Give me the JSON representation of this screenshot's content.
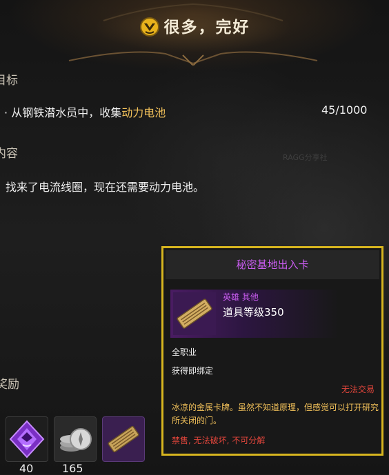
{
  "header": {
    "title": "很多，完好",
    "badge_icon": "gold-emblem-icon"
  },
  "objective": {
    "heading": "目标",
    "bullet": "·",
    "text_prefix": "从钢铁潜水员中，收集",
    "text_highlight": "动力电池",
    "progress": "45/1000"
  },
  "content": {
    "heading": "内容",
    "text": "找来了电流线圈，现在还需要动力电池。"
  },
  "faded_label": "RAGG分享社",
  "rewards": {
    "heading": "奖励",
    "items": [
      {
        "icon": "purple-crystal-icon",
        "quantity": "40"
      },
      {
        "icon": "silver-coin-stack-icon",
        "quantity": "165"
      },
      {
        "icon": "access-card-icon",
        "quantity": ""
      }
    ]
  },
  "tooltip": {
    "title": "秘密基地出入卡",
    "rarity": "英雄 其他",
    "item_level": "道具等级350",
    "class_restriction": "全职业",
    "bind": "获得即绑定",
    "trade_status": "无法交易",
    "description": "冰凉的金属卡牌。虽然不知道原理，但感觉可以打开研究所关闭的门。",
    "restrictions": [
      "禁售",
      "无法破坏",
      "不可分解"
    ],
    "restriction_separator": ", ",
    "colors": {
      "border": "#d7b51f",
      "title": "#c95cf0",
      "description": "#f2c15a",
      "warning": "#e0453b"
    }
  }
}
